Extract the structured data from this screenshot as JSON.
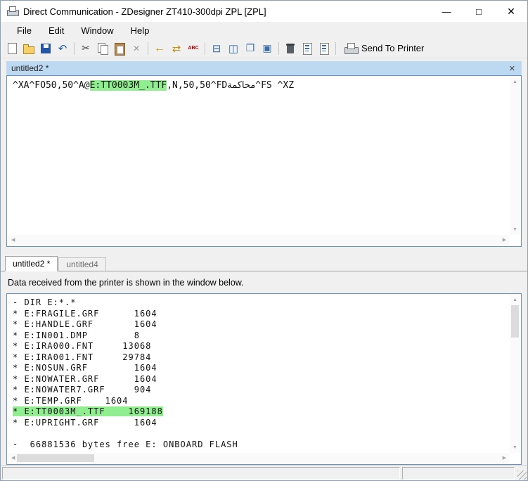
{
  "window": {
    "title": "Direct Communication - ZDesigner ZT410-300dpi ZPL [ZPL]",
    "minimize_glyph": "—",
    "maximize_glyph": "□",
    "close_glyph": "✕"
  },
  "menu": {
    "items": [
      {
        "label": "File"
      },
      {
        "label": "Edit"
      },
      {
        "label": "Window"
      },
      {
        "label": "Help"
      }
    ]
  },
  "toolbar": {
    "send_to_printer_label": "Send To Printer",
    "groups": [
      [
        {
          "name": "new-document-icon",
          "cls": "ic-page"
        },
        {
          "name": "open-folder-icon",
          "cls": "ic-folder"
        },
        {
          "name": "save-icon",
          "cls": "ic-save"
        },
        {
          "name": "undo-icon",
          "glyph": "↶",
          "color": "#1f5faa",
          "size": "15px"
        }
      ],
      [
        {
          "name": "cut-icon",
          "glyph": "✂",
          "color": "#444444"
        },
        {
          "name": "copy-icon",
          "cls": "ic-copy"
        },
        {
          "name": "paste-icon",
          "cls": "ic-paste"
        },
        {
          "name": "delete-icon",
          "glyph": "✕",
          "color": "#9a9a9a",
          "size": "12px"
        }
      ],
      [
        {
          "name": "arrow-left-icon",
          "glyph": "←",
          "color": "#c79100",
          "size": "16px"
        },
        {
          "name": "transfer-icon",
          "glyph": "⇄",
          "color": "#c79100",
          "size": "15px"
        },
        {
          "name": "spell-check-icon",
          "glyph": "ABC",
          "cls": "ic-abc",
          "color": "#b30000"
        }
      ],
      [
        {
          "name": "tile-horizontal-icon",
          "glyph": "⊟",
          "color": "#3a6ea5",
          "size": "15px"
        },
        {
          "name": "tile-vertical-icon",
          "glyph": "◫",
          "color": "#3a6ea5",
          "size": "15px"
        },
        {
          "name": "cascade-windows-icon",
          "glyph": "❐",
          "color": "#3a6ea5",
          "size": "14px"
        },
        {
          "name": "arrange-icons-icon",
          "glyph": "▣",
          "color": "#3a6ea5",
          "size": "14px"
        }
      ],
      [
        {
          "name": "printer-memory-icon",
          "cls": "ic-canister"
        },
        {
          "name": "send-file-icon",
          "cls": "ic-pageblue"
        },
        {
          "name": "receive-file-icon",
          "cls": "ic-pageblue"
        }
      ]
    ]
  },
  "editor_window": {
    "caption": "untitled2 *",
    "close_glyph": "✕",
    "zpl": {
      "pre": "^XA^FO50,50^A@",
      "highlight": "E:TT0003M_.TTF",
      "mid": ",N,50,50^FD",
      "arabic": "محاكمة",
      "post": "^FS ^XZ"
    }
  },
  "tabs": [
    {
      "label": "untitled2 *"
    },
    {
      "label": "untitled4"
    }
  ],
  "output_panel": {
    "label": "Data received from the printer is shown in the window below."
  },
  "console": {
    "lines": [
      {
        "text": "- DIR E:*.*",
        "highlight": false
      },
      {
        "text": "* E:FRAGILE.GRF      1604",
        "highlight": false
      },
      {
        "text": "* E:HANDLE.GRF       1604",
        "highlight": false
      },
      {
        "text": "* E:IN001.DMP        8",
        "highlight": false
      },
      {
        "text": "* E:IRA000.FNT     13068",
        "highlight": false
      },
      {
        "text": "* E:IRA001.FNT     29784",
        "highlight": false
      },
      {
        "text": "* E:NOSUN.GRF        1604",
        "highlight": false
      },
      {
        "text": "* E:NOWATER.GRF      1604",
        "highlight": false
      },
      {
        "text": "* E:NOWATER7.GRF     904",
        "highlight": false
      },
      {
        "text": "* E:TEMP.GRF    1604",
        "highlight": false
      },
      {
        "text": "* E:TT0003M_.TTF    169188",
        "highlight": true
      },
      {
        "text": "* E:UPRIGHT.GRF      1604",
        "highlight": false
      },
      {
        "text": "",
        "highlight": false
      },
      {
        "text": "-  66881536 bytes free E: ONBOARD FLASH",
        "highlight": false
      }
    ]
  },
  "icons": {
    "up": "▲",
    "down": "▼",
    "left": "◀",
    "right": "▶"
  },
  "colors": {
    "highlight_green": "#90ee90",
    "panel_border_blue": "#6a93bd",
    "caption_blue": "#bdd9f2",
    "window_bg": "#f0f0f0"
  }
}
